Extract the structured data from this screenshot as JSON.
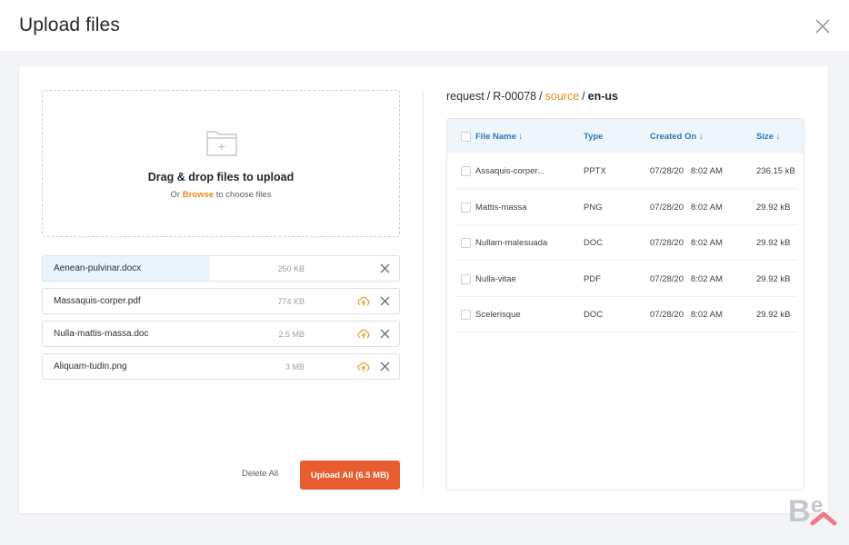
{
  "header": {
    "title": "Upload files"
  },
  "dropzone": {
    "title": "Drag & drop files to upload",
    "sub_prefix": "Or",
    "browse_label": "Browse",
    "sub_suffix": "to choose files"
  },
  "files": [
    {
      "name": "Aenean-pulvinar.docx",
      "size": "250 KB",
      "progress": 0.47,
      "show_upload": false
    },
    {
      "name": "Massaquis-corper.pdf",
      "size": "774 KB",
      "progress": 0,
      "show_upload": true
    },
    {
      "name": "Nulla-mattis-massa.doc",
      "size": "2.5 MB",
      "progress": 0,
      "show_upload": true
    },
    {
      "name": "Aliquam-tudin.png",
      "size": "3 MB",
      "progress": 0,
      "show_upload": true
    }
  ],
  "actions": {
    "delete_all": "Delete All",
    "upload_all": "Upload All (6.5 MB)"
  },
  "breadcrumb": {
    "part1": "request",
    "part2": "R-00078",
    "part3": "source",
    "part4": "en-us"
  },
  "table": {
    "headers": {
      "name": "File Name ↓",
      "type": "Type",
      "created": "Created On ↓",
      "size": "Size ↓"
    },
    "rows": [
      {
        "name": "Assaquis-corper...",
        "type": "PPTX",
        "date": "07/28/20",
        "time": "8:02 AM",
        "size": "236.15 kB"
      },
      {
        "name": "Mattis-massa",
        "type": "PNG",
        "date": "07/28/20",
        "time": "8:02 AM",
        "size": "29.92 kB"
      },
      {
        "name": "Nullam-malesuada",
        "type": "DOC",
        "date": "07/28/20",
        "time": "8:02 AM",
        "size": "29.92 kB"
      },
      {
        "name": "Nulla-vitae",
        "type": "PDF",
        "date": "07/28/20",
        "time": "8:02 AM",
        "size": "29.92 kB"
      },
      {
        "name": "Scelerisque",
        "type": "DOC",
        "date": "07/28/20",
        "time": "8:02 AM",
        "size": "29.92 kB"
      }
    ]
  },
  "colors": {
    "accent": "#e85d2f",
    "link": "#e8891c",
    "header_blue": "#2a78b8",
    "progress": "#eaf4fc"
  },
  "icons": {
    "close": "close-icon",
    "folder": "folder-plus-icon",
    "upload": "cloud-upload-icon",
    "remove": "remove-icon",
    "logo": "behance-logo"
  }
}
